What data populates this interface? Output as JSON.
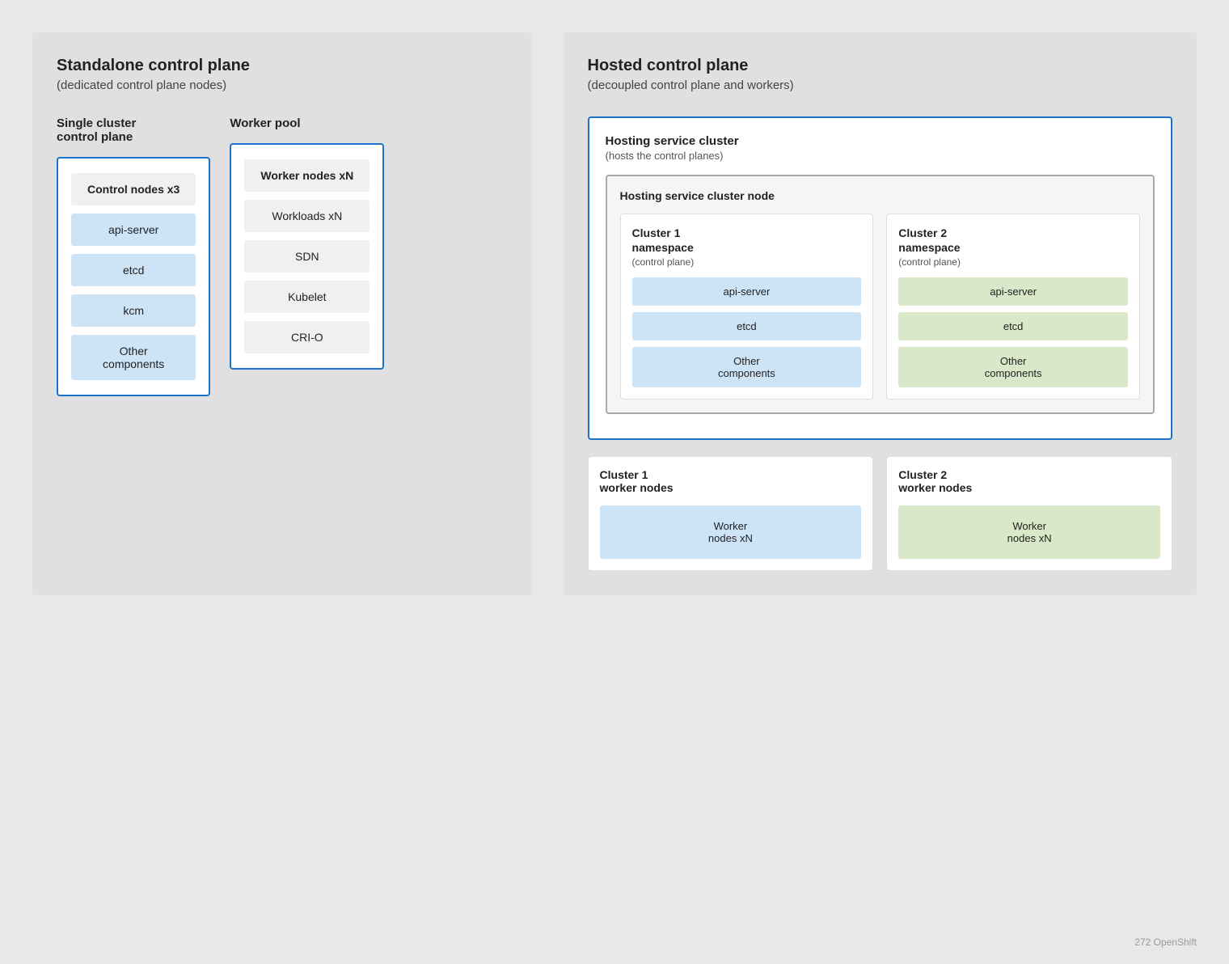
{
  "left": {
    "title": "Standalone control plane",
    "subtitle": "(dedicated control plane nodes)",
    "single_cluster": {
      "title": "Single cluster\ncontrol plane",
      "node_box": {
        "label": "Control nodes  x3",
        "items": [
          "api-server",
          "etcd",
          "kcm",
          "Other\ncomponents"
        ]
      }
    },
    "worker_pool": {
      "title": "Worker pool",
      "node_box": {
        "label": "Worker nodes  xN",
        "items": [
          "Workloads xN",
          "SDN",
          "Kubelet",
          "CRI-O"
        ]
      }
    }
  },
  "right": {
    "title": "Hosted control plane",
    "subtitle": "(decoupled control plane and workers)",
    "hosting_cluster": {
      "title": "Hosting service cluster",
      "subtitle": "(hosts the control planes)",
      "node": {
        "title": "Hosting service cluster node",
        "cluster1": {
          "label": "Cluster 1\nnamespace",
          "sublabel": "(control plane)",
          "items": [
            "api-server",
            "etcd",
            "Other\ncomponents"
          ],
          "color": "blue"
        },
        "cluster2": {
          "label": "Cluster 2\nnamespace",
          "sublabel": "(control plane)",
          "items": [
            "api-server",
            "etcd",
            "Other\ncomponents"
          ],
          "color": "green"
        }
      }
    },
    "workers": {
      "cluster1": {
        "title": "Cluster 1\nworker nodes",
        "item": "Worker\nnodes xN",
        "color": "blue"
      },
      "cluster2": {
        "title": "Cluster 2\nworker nodes",
        "item": "Worker\nnodes xN",
        "color": "green"
      }
    }
  },
  "watermark": "272  OpenShift"
}
